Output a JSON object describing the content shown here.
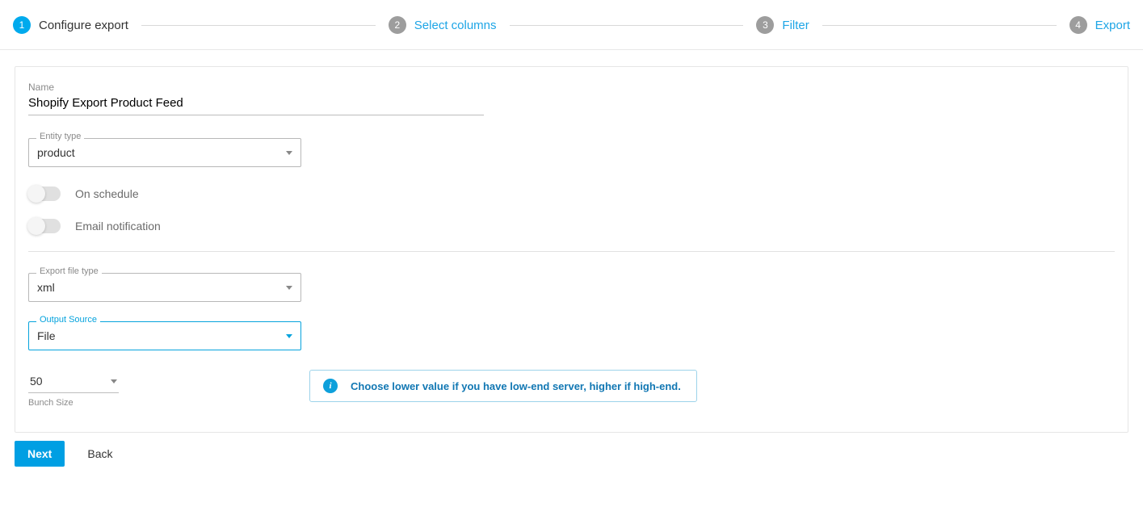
{
  "stepper": {
    "steps": [
      {
        "num": "1",
        "label": "Configure export",
        "active": true
      },
      {
        "num": "2",
        "label": "Select columns",
        "active": false
      },
      {
        "num": "3",
        "label": "Filter",
        "active": false
      },
      {
        "num": "4",
        "label": "Export",
        "active": false
      }
    ]
  },
  "form": {
    "name_label": "Name",
    "name_value": "Shopify Export Product Feed",
    "entity_type_label": "Entity type",
    "entity_type_value": "product",
    "on_schedule_label": "On schedule",
    "email_notification_label": "Email notification",
    "export_file_type_label": "Export file type",
    "export_file_type_value": "xml",
    "output_source_label": "Output Source",
    "output_source_value": "File",
    "bunch_size_value": "50",
    "bunch_size_label": "Bunch Size",
    "info_text": "Choose lower value if you have low-end server, higher if high-end."
  },
  "footer": {
    "next": "Next",
    "back": "Back"
  }
}
